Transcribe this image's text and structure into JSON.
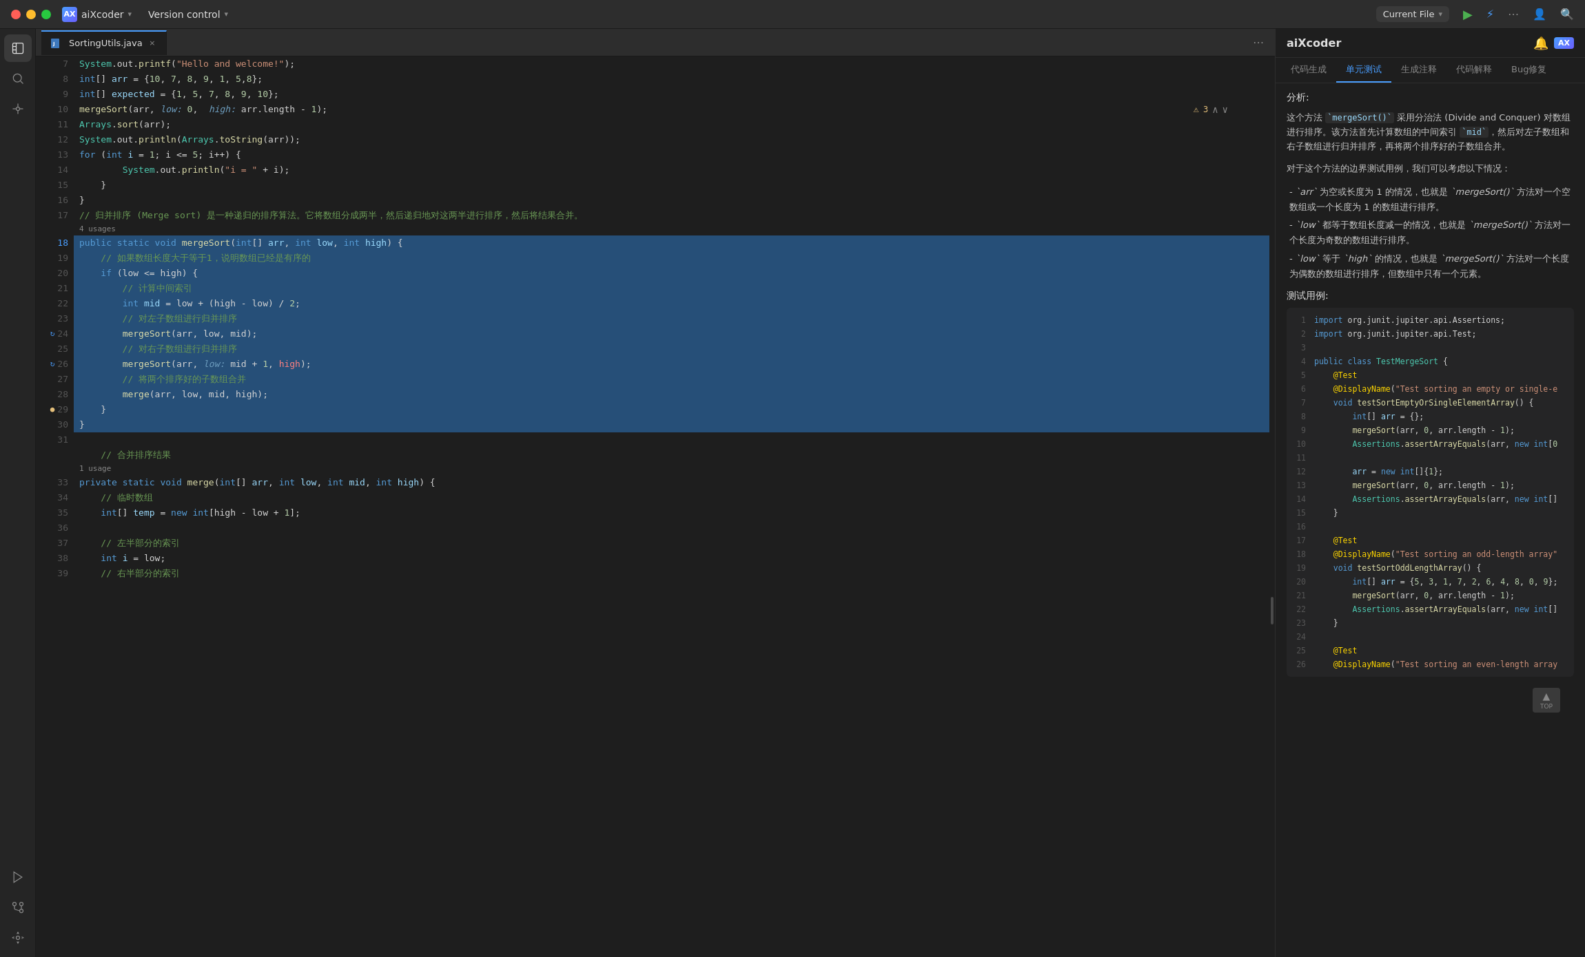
{
  "titlebar": {
    "traffic_lights": [
      "red",
      "yellow",
      "green"
    ],
    "app_logo": "AX",
    "app_name": "aiXcoder",
    "version_control": "Version control",
    "current_file": "Current File",
    "dropdown_symbol": "▾"
  },
  "tabs": [
    {
      "label": "SortingUtils.java",
      "active": true
    }
  ],
  "activity_bar": {
    "icons": [
      "file-tree",
      "search",
      "more",
      "run",
      "git",
      "settings"
    ]
  },
  "code": {
    "lines": [
      {
        "num": 7,
        "content": "    System.out.printf(\"Hello and welcome!\");",
        "selected": false
      },
      {
        "num": 8,
        "content": "    int[] arr = {10, 7, 8, 9, 1, 5,8};",
        "selected": false
      },
      {
        "num": 9,
        "content": "    int[] expected = {1, 5, 7, 8, 9, 10};",
        "selected": false
      },
      {
        "num": 10,
        "content": "    mergeSort(arr, low: 0,  high: arr.length - 1);",
        "selected": false,
        "has_hint": true
      },
      {
        "num": 11,
        "content": "    Arrays.sort(arr);",
        "selected": false
      },
      {
        "num": 12,
        "content": "    System.out.println(Arrays.toString(arr));",
        "selected": false
      },
      {
        "num": 13,
        "content": "    for (int i = 1; i <= 5; i++) {",
        "selected": false
      },
      {
        "num": 14,
        "content": "        System.out.println(\"i = \" + i);",
        "selected": false
      },
      {
        "num": 15,
        "content": "    }",
        "selected": false
      },
      {
        "num": 16,
        "content": "}",
        "selected": false
      },
      {
        "num": 17,
        "content": "// 归并排序 (Merge sort) 是一种递归的排序算法。它将数组分成两半，然后递归地对这两半进行排序，然后将结果合并。",
        "selected": false,
        "is_comment": true
      },
      {
        "num": "",
        "content": "4 usages",
        "is_usage": true
      },
      {
        "num": 18,
        "content": "public static void mergeSort(int[] arr, int low, int high) {",
        "selected": true,
        "has_gutter": "refresh"
      },
      {
        "num": 19,
        "content": "    // 如果数组长度大于等于1，说明数组已经是有序的",
        "selected": true,
        "is_comment": true
      },
      {
        "num": 20,
        "content": "    if (low <= high) {",
        "selected": true
      },
      {
        "num": 21,
        "content": "        // 计算中间索引",
        "selected": true,
        "is_comment": true
      },
      {
        "num": 22,
        "content": "        int mid = low + (high - low) / 2;",
        "selected": true
      },
      {
        "num": 23,
        "content": "        // 对左子数组进行归并排序",
        "selected": true,
        "is_comment": true
      },
      {
        "num": 24,
        "content": "        mergeSort(arr, low, mid);",
        "selected": true,
        "has_gutter": "refresh"
      },
      {
        "num": 25,
        "content": "        // 对右子数组进行归并排序",
        "selected": true,
        "is_comment": true
      },
      {
        "num": 26,
        "content": "        mergeSort(arr,  low: mid + 1, high);",
        "selected": true,
        "has_gutter": "refresh",
        "has_hint2": true
      },
      {
        "num": 27,
        "content": "        // 将两个排序好的子数组合并",
        "selected": true,
        "is_comment": true
      },
      {
        "num": 28,
        "content": "        merge(arr, low, mid, high);",
        "selected": true
      },
      {
        "num": 29,
        "content": "    }",
        "selected": true,
        "has_gutter": "warn"
      },
      {
        "num": 30,
        "content": "}",
        "selected": true
      },
      {
        "num": 31,
        "content": "",
        "selected": false
      },
      {
        "num": "",
        "content": "// 合并排序结果",
        "is_comment_line": true
      },
      {
        "num": "",
        "content": "1 usage",
        "is_usage": true
      },
      {
        "num": 33,
        "content": "private static void merge(int[] arr, int low, int mid, int high) {",
        "selected": false
      },
      {
        "num": 34,
        "content": "    // 临时数组",
        "selected": false,
        "is_comment": true
      },
      {
        "num": 35,
        "content": "    int[] temp = new int[high - low + 1];",
        "selected": false
      },
      {
        "num": 36,
        "content": "",
        "selected": false
      },
      {
        "num": 37,
        "content": "    // 左半部分的索引",
        "selected": false,
        "is_comment": true
      },
      {
        "num": 38,
        "content": "    int i = low;",
        "selected": false
      },
      {
        "num": 39,
        "content": "    // 右半部分的索引",
        "selected": false,
        "is_comment": true
      }
    ]
  },
  "right_panel": {
    "title": "aiXcoder",
    "tabs": [
      "代码生成",
      "单元测试",
      "生成注释",
      "代码解释",
      "Bug修复"
    ],
    "active_tab": "单元测试",
    "analysis_label": "分析:",
    "analysis_paragraphs": [
      "这个方法 `mergeSort()` 采用分治法 (Divide and Conquer) 对数组进行排序。该方法首先计算数组的中间索引 `mid`，然后对左子数组和右子数组进行归并排序，再将两个排序好的子数组合并。",
      "对于这个方法的边界测试用例，我们可以考虑以下情况："
    ],
    "bullet_items": [
      "- `arr` 为空或长度为 1 的情况，也就是 `mergeSort()` 方法对一个空数组或一个长度为 1 的数组进行排序。",
      "- `low` 都等于数组长度减一的情况，也就是 `mergeSort()` 方法对一个长度为奇数的数组进行排序。",
      "- `low` 等于 `high` 的情况，也就是 `mergeSort()` 方法对一个长度为偶数的数组进行排序，但数组中只有一个元素。"
    ],
    "test_example_label": "测试用例:",
    "code_lines": [
      {
        "ln": 1,
        "code": "import org.junit.jupiter.api.Assertions;"
      },
      {
        "ln": 2,
        "code": "import org.junit.jupiter.api.Test;"
      },
      {
        "ln": 3,
        "code": ""
      },
      {
        "ln": 4,
        "code": "public class TestMergeSort {"
      },
      {
        "ln": 5,
        "code": "    @Test"
      },
      {
        "ln": 6,
        "code": "    @DisplayName(\"Test sorting an empty or single-e"
      },
      {
        "ln": 7,
        "code": "    void testSortEmptyOrSingleElementArray() {"
      },
      {
        "ln": 8,
        "code": "        int[] arr = {};"
      },
      {
        "ln": 9,
        "code": "        mergeSort(arr, 0, arr.length - 1);"
      },
      {
        "ln": 10,
        "code": "        Assertions.assertArrayEquals(arr, new int[0"
      },
      {
        "ln": 11,
        "code": ""
      },
      {
        "ln": 12,
        "code": "        arr = new int[]{1};"
      },
      {
        "ln": 13,
        "code": "        mergeSort(arr, 0, arr.length - 1);"
      },
      {
        "ln": 14,
        "code": "        Assertions.assertArrayEquals(arr, new int[]"
      },
      {
        "ln": 15,
        "code": "    }"
      },
      {
        "ln": 16,
        "code": ""
      },
      {
        "ln": 17,
        "code": "    @Test"
      },
      {
        "ln": 18,
        "code": "    @DisplayName(\"Test sorting an odd-length array\""
      },
      {
        "ln": 19,
        "code": "    void testSortOddLengthArray() {"
      },
      {
        "ln": 20,
        "code": "        int[] arr = {5, 3, 1, 7, 2, 6, 4, 8, 0, 9};"
      },
      {
        "ln": 21,
        "code": "        mergeSort(arr, 0, arr.length - 1);"
      },
      {
        "ln": 22,
        "code": "        Assertions.assertArrayEquals(arr, new int[]"
      },
      {
        "ln": 23,
        "code": "    }"
      },
      {
        "ln": 24,
        "code": ""
      },
      {
        "ln": 25,
        "code": "    @Test"
      },
      {
        "ln": 26,
        "code": "    @DisplayName(\"Test sorting an even-length array"
      }
    ],
    "scroll_top_label": "TOP"
  }
}
